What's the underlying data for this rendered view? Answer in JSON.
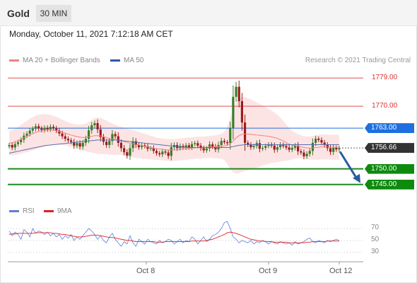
{
  "header": {
    "instrument": "Gold",
    "timeframe": "30 MIN",
    "timestamp": "Monday, October 11, 2021 7:12:18 AM CET"
  },
  "legend": {
    "ma20_label": "MA 20 + Bollinger Bands",
    "ma50_label": "MA 50",
    "copyright": "Research © 2021 Trading Central"
  },
  "colors": {
    "up": "#3a7d2a",
    "down": "#9b1c1c",
    "band": "#fde4e4",
    "resistance": "#e05050",
    "pivot": "#1e6fe0",
    "support": "#1f8a1f",
    "current": "#333333",
    "arrow": "#2a5aa0"
  },
  "chart_data": {
    "type": "candlestick",
    "x_ticks": [
      "Oct 8",
      "Oct 9",
      "Oct 12"
    ],
    "y_range": [
      1742,
      1782
    ],
    "levels": [
      {
        "value": 1779.0,
        "label": "1779.00",
        "kind": "resistance"
      },
      {
        "value": 1770.0,
        "label": "1770.00",
        "kind": "resistance"
      },
      {
        "value": 1763.0,
        "label": "1763.00",
        "kind": "pivot"
      },
      {
        "value": 1756.66,
        "label": "1756.66",
        "kind": "current"
      },
      {
        "value": 1750.0,
        "label": "1750.00",
        "kind": "support"
      },
      {
        "value": 1745.0,
        "label": "1745.00",
        "kind": "support"
      }
    ],
    "close": [
      1757.6,
      1756.8,
      1757.9,
      1758.5,
      1759.3,
      1760.6,
      1761.2,
      1762.2,
      1762.8,
      1763.6,
      1762.9,
      1762.4,
      1763.1,
      1762.6,
      1763.4,
      1762.9,
      1762.2,
      1761.3,
      1760.4,
      1759.6,
      1759.1,
      1758.6,
      1757.4,
      1758.2,
      1757.1,
      1758.3,
      1759.6,
      1762.3,
      1763.9,
      1764.6,
      1762.6,
      1760.1,
      1758.6,
      1757.6,
      1758.9,
      1761.1,
      1760.4,
      1758.3,
      1756.6,
      1755.3,
      1754.2,
      1756.6,
      1758.8,
      1757.6,
      1756.9,
      1757.5,
      1757.2,
      1756.4,
      1756.6,
      1755.7,
      1755.0,
      1754.6,
      1755.5,
      1755.2,
      1754.1,
      1756.9,
      1757.6,
      1756.6,
      1757.3,
      1756.8,
      1757.5,
      1756.9,
      1757.9,
      1758.2,
      1757.4,
      1756.6,
      1755.9,
      1756.5,
      1757.8,
      1757.1,
      1756.2,
      1757.6,
      1758.9,
      1758.5,
      1758.2,
      1763.0,
      1773.0,
      1776.2,
      1771.6,
      1764.8,
      1758.3,
      1757.7,
      1756.9,
      1757.3,
      1758.2,
      1756.4,
      1756.7,
      1757.3,
      1757.8,
      1757.4,
      1756.1,
      1756.9,
      1757.7,
      1757.3,
      1756.8,
      1756.1,
      1756.7,
      1757.4,
      1755.6,
      1755.2,
      1754.0,
      1754.8,
      1755.7,
      1758.3,
      1759.6,
      1759.2,
      1758.4,
      1757.6,
      1756.6,
      1755.4,
      1756.7,
      1756.2,
      1756.66
    ],
    "ma20": [
      1758.2,
      1758.3,
      1758.6,
      1759.0,
      1759.4,
      1759.9,
      1760.3,
      1760.8,
      1761.2,
      1761.6,
      1761.9,
      1762.1,
      1762.3,
      1762.4,
      1762.4,
      1762.3,
      1762.2,
      1762.0,
      1761.7,
      1761.4,
      1761.1,
      1760.8,
      1760.5,
      1760.3,
      1760.1,
      1760.0,
      1760.0,
      1760.2,
      1760.4,
      1760.6,
      1760.6,
      1760.5,
      1760.3,
      1760.0,
      1759.7,
      1759.5,
      1759.3,
      1759.1,
      1758.9,
      1758.7,
      1758.4,
      1758.2,
      1758.0,
      1757.8,
      1757.6,
      1757.4,
      1757.2,
      1757.0,
      1756.8,
      1756.6,
      1756.4,
      1756.3,
      1756.2,
      1756.1,
      1756.0,
      1756.0,
      1756.0,
      1756.1,
      1756.2,
      1756.3,
      1756.4,
      1756.5,
      1756.6,
      1756.7,
      1756.8,
      1756.8,
      1756.8,
      1756.9,
      1757.0,
      1757.0,
      1757.0,
      1757.1,
      1757.2,
      1757.3,
      1757.5,
      1758.0,
      1758.9,
      1759.9,
      1760.6,
      1761.0,
      1761.1,
      1761.1,
      1761.0,
      1760.9,
      1760.8,
      1760.7,
      1760.6,
      1760.5,
      1760.4,
      1760.2,
      1760.0,
      1759.7,
      1759.3,
      1758.9,
      1758.4,
      1757.9,
      1757.6,
      1757.4,
      1757.2,
      1757.0,
      1756.8,
      1756.7,
      1756.6,
      1756.7,
      1756.8,
      1756.9,
      1757.0,
      1757.0,
      1757.0,
      1756.9,
      1756.9,
      1756.9,
      1756.9
    ],
    "ma50": [
      1755.0,
      1755.2,
      1755.4,
      1755.6,
      1755.8,
      1756.0,
      1756.2,
      1756.4,
      1756.6,
      1756.8,
      1757.0,
      1757.2,
      1757.4,
      1757.5,
      1757.6,
      1757.7,
      1757.8,
      1757.9,
      1758.0,
      1758.1,
      1758.2,
      1758.3,
      1758.4,
      1758.5,
      1758.6,
      1758.7,
      1758.8,
      1758.9,
      1759.0,
      1759.1,
      1759.2,
      1759.2,
      1759.2,
      1759.2,
      1759.2,
      1759.2,
      1759.2,
      1759.1,
      1759.0,
      1758.9,
      1758.8,
      1758.7,
      1758.6,
      1758.5,
      1758.4,
      1758.3,
      1758.2,
      1758.1,
      1758.0,
      1757.9,
      1757.8,
      1757.7,
      1757.6,
      1757.5,
      1757.4,
      1757.3,
      1757.2,
      1757.1,
      1757.0,
      1756.9,
      1756.8,
      1756.8,
      1756.8,
      1756.8,
      1756.8,
      1756.8,
      1756.8,
      1756.8,
      1756.8,
      1756.8,
      1756.8,
      1756.8,
      1756.8,
      1756.8,
      1756.8,
      1756.9,
      1757.1,
      1757.3,
      1757.5,
      1757.6,
      1757.7,
      1757.7,
      1757.7,
      1757.7,
      1757.7,
      1757.7,
      1757.7,
      1757.7,
      1757.7,
      1757.7,
      1757.7,
      1757.7,
      1757.7,
      1757.7,
      1757.7,
      1757.7,
      1757.7,
      1757.7,
      1757.7,
      1757.7,
      1757.7,
      1757.7,
      1757.7,
      1757.7,
      1757.7,
      1757.7,
      1757.7,
      1757.7,
      1757.7,
      1757.7,
      1757.7,
      1757.7,
      1757.7
    ],
    "band_width": [
      4.0,
      4.0,
      4.2,
      4.4,
      4.6,
      4.8,
      5.0,
      5.2,
      5.3,
      5.4,
      5.4,
      5.3,
      5.2,
      5.0,
      4.8,
      4.6,
      4.4,
      4.2,
      4.0,
      3.9,
      3.8,
      3.8,
      3.8,
      3.9,
      4.0,
      4.2,
      4.4,
      4.8,
      5.2,
      5.6,
      5.8,
      5.8,
      5.6,
      5.4,
      5.2,
      5.0,
      4.8,
      4.6,
      4.5,
      4.4,
      4.4,
      4.4,
      4.4,
      4.3,
      4.2,
      4.1,
      4.0,
      3.9,
      3.8,
      3.7,
      3.6,
      3.5,
      3.5,
      3.5,
      3.5,
      3.5,
      3.5,
      3.5,
      3.5,
      3.5,
      3.5,
      3.5,
      3.5,
      3.5,
      3.5,
      3.5,
      3.5,
      3.5,
      3.5,
      3.6,
      3.7,
      3.8,
      4.0,
      4.5,
      6.0,
      8.0,
      10.0,
      11.5,
      12.0,
      12.0,
      11.8,
      11.5,
      11.2,
      10.8,
      10.4,
      10.0,
      9.6,
      9.2,
      8.8,
      8.4,
      8.0,
      7.6,
      7.0,
      6.4,
      5.8,
      5.2,
      4.6,
      4.2,
      3.9,
      3.7,
      3.6,
      3.6,
      3.7,
      3.8,
      3.9,
      4.0,
      4.0,
      4.0,
      4.0,
      4.0,
      4.0,
      4.0,
      4.0
    ],
    "arrow": {
      "from": 1755.5,
      "to": 1745.0
    }
  },
  "rsi": {
    "label": "RSI",
    "ma_label": "9MA",
    "ticks": [
      "70",
      "50",
      "30"
    ],
    "tick_values": [
      70,
      50,
      30
    ],
    "y_range": [
      20,
      82
    ],
    "values": [
      66,
      58,
      64,
      60,
      52,
      68,
      64,
      56,
      70,
      62,
      66,
      64,
      60,
      64,
      58,
      62,
      56,
      60,
      52,
      58,
      54,
      60,
      50,
      56,
      52,
      58,
      64,
      70,
      66,
      60,
      52,
      58,
      50,
      46,
      56,
      62,
      52,
      46,
      40,
      48,
      44,
      58,
      46,
      40,
      52,
      48,
      44,
      52,
      48,
      46,
      44,
      50,
      46,
      48,
      52,
      50,
      44,
      48,
      52,
      46,
      50,
      48,
      56,
      52,
      44,
      50,
      56,
      48,
      52,
      58,
      60,
      64,
      70,
      80,
      82,
      70,
      56,
      52,
      46,
      50,
      48,
      46,
      50,
      44,
      48,
      46,
      50,
      48,
      44,
      48,
      46,
      44,
      48,
      46,
      44,
      46,
      42,
      48,
      44,
      46,
      48,
      52,
      54,
      48,
      46,
      50,
      48,
      46,
      50,
      48,
      50,
      52,
      50
    ],
    "ma9": [
      60,
      61,
      61,
      62,
      62,
      62,
      62,
      62,
      62,
      63,
      63,
      63,
      63,
      63,
      63,
      62,
      62,
      61,
      60,
      60,
      59,
      58,
      57,
      56,
      56,
      56,
      57,
      58,
      59,
      59,
      59,
      58,
      57,
      56,
      55,
      55,
      54,
      53,
      52,
      51,
      50,
      50,
      49,
      48,
      48,
      48,
      48,
      48,
      48,
      48,
      47,
      47,
      47,
      48,
      48,
      48,
      48,
      48,
      48,
      48,
      48,
      48,
      49,
      49,
      49,
      49,
      49,
      50,
      51,
      52,
      54,
      56,
      58,
      60,
      63,
      64,
      63,
      62,
      60,
      58,
      56,
      54,
      52,
      51,
      50,
      49,
      49,
      48,
      48,
      48,
      47,
      47,
      47,
      47,
      47,
      46,
      46,
      46,
      46,
      46,
      46,
      47,
      47,
      48,
      48,
      48,
      48,
      48,
      49,
      49,
      49,
      49,
      49
    ]
  }
}
